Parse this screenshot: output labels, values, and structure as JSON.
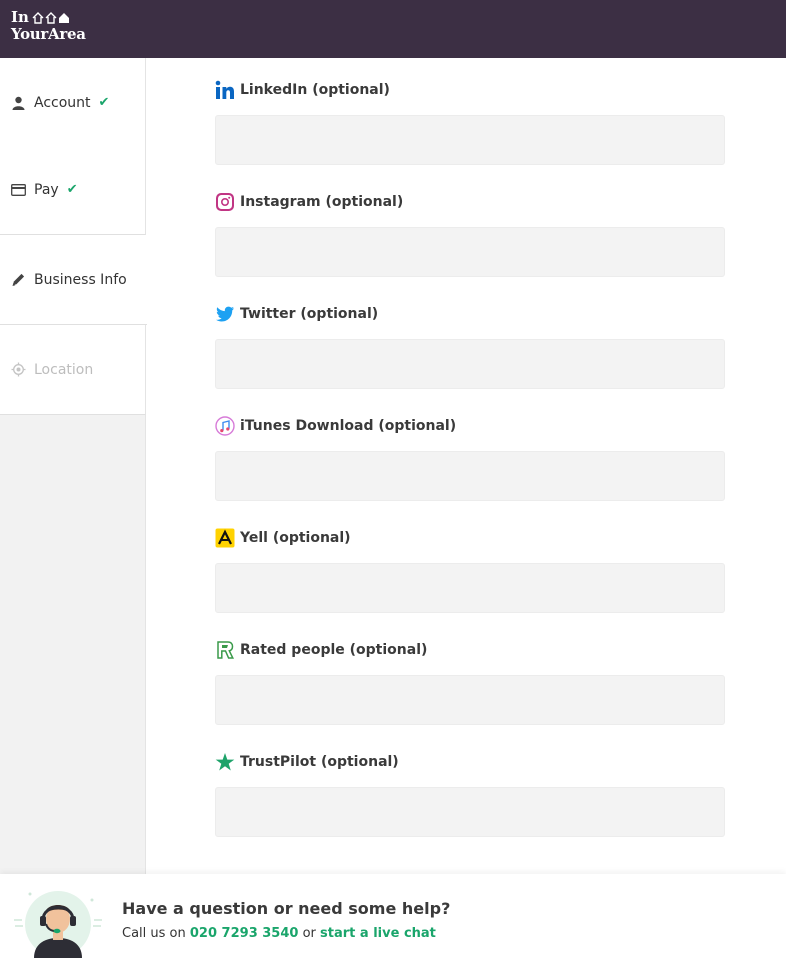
{
  "brand": {
    "line1": "In",
    "line2": "YourArea"
  },
  "sidebar": {
    "items": [
      {
        "label": "Account",
        "icon": "user-icon",
        "done": true
      },
      {
        "label": "Pay",
        "icon": "credit-card-icon",
        "done": true
      },
      {
        "label": "Business Info",
        "icon": "pencil-icon",
        "active": true
      },
      {
        "label": "Location",
        "icon": "location-target-icon",
        "disabled": true
      }
    ],
    "check_glyph": "✔"
  },
  "form": {
    "fields": [
      {
        "label": "LinkedIn (optional)",
        "icon": "linkedin-icon",
        "value": ""
      },
      {
        "label": "Instagram (optional)",
        "icon": "instagram-icon",
        "value": ""
      },
      {
        "label": "Twitter (optional)",
        "icon": "twitter-icon",
        "value": ""
      },
      {
        "label": "iTunes Download (optional)",
        "icon": "itunes-icon",
        "value": ""
      },
      {
        "label": "Yell (optional)",
        "icon": "yell-icon",
        "value": ""
      },
      {
        "label": "Rated people (optional)",
        "icon": "rated-people-icon",
        "value": ""
      },
      {
        "label": "TrustPilot (optional)",
        "icon": "trustpilot-icon",
        "value": ""
      }
    ]
  },
  "help": {
    "title": "Have a question or need some help?",
    "prefix": "Call us on",
    "phone": "020 7293 3540",
    "or": "or",
    "chat_link": "start a live chat"
  },
  "colors": {
    "header": "#3c2f44",
    "accent": "#1aa56b",
    "input_bg": "#f3f3f3"
  }
}
